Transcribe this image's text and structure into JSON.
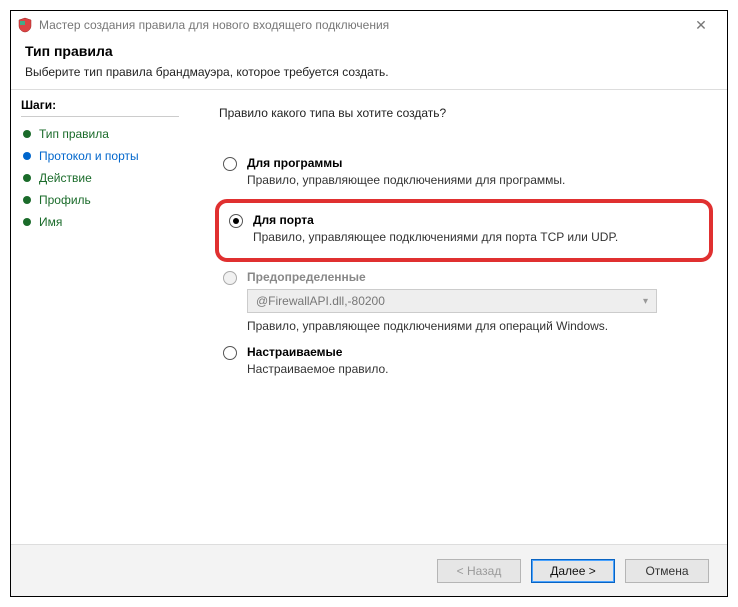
{
  "window": {
    "title": "Мастер создания правила для нового входящего подключения"
  },
  "header": {
    "title": "Тип правила",
    "subtitle": "Выберите тип правила брандмауэра, которое требуется создать."
  },
  "sidebar": {
    "title": "Шаги:",
    "steps": [
      {
        "label": "Тип правила"
      },
      {
        "label": "Протокол и порты"
      },
      {
        "label": "Действие"
      },
      {
        "label": "Профиль"
      },
      {
        "label": "Имя"
      }
    ]
  },
  "content": {
    "question": "Правило какого типа вы хотите создать?",
    "options": {
      "program": {
        "label": "Для программы",
        "desc": "Правило, управляющее подключениями для программы."
      },
      "port": {
        "label": "Для порта",
        "desc": "Правило, управляющее подключениями для порта TCP или UDP."
      },
      "predefined": {
        "label": "Предопределенные",
        "dropdown": "@FirewallAPI.dll,-80200",
        "desc": "Правило, управляющее подключениями для операций Windows."
      },
      "custom": {
        "label": "Настраиваемые",
        "desc": "Настраиваемое правило."
      }
    }
  },
  "footer": {
    "back": "< Назад",
    "next": "Далее >",
    "cancel": "Отмена"
  }
}
